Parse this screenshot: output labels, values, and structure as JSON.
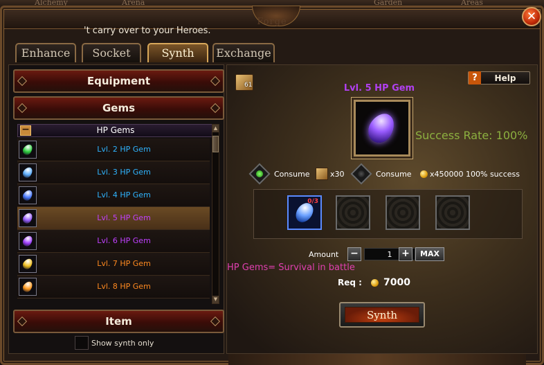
{
  "background_tabs": [
    "Alchemy",
    "Arena",
    "Garden",
    "Areas"
  ],
  "window": {
    "title": "Forge",
    "close_label": "✕"
  },
  "notice": "'t carry over to your Heroes.",
  "tabs": [
    {
      "label": "Enhance",
      "active": false
    },
    {
      "label": "Socket",
      "active": false
    },
    {
      "label": "Synth",
      "active": true
    },
    {
      "label": "Exchange",
      "active": false
    }
  ],
  "categories": {
    "equipment": "Equipment",
    "gems": "Gems",
    "item": "Item"
  },
  "subcategory": {
    "label": "HP Gems",
    "collapse": "−"
  },
  "gem_list": [
    {
      "label": "Lvl. 2 HP Gem",
      "color": "#2fb4ff",
      "gem": "#30d040",
      "selected": false
    },
    {
      "label": "Lvl. 3 HP Gem",
      "color": "#2fb4ff",
      "gem": "#60b0ff",
      "selected": false
    },
    {
      "label": "Lvl. 4 HP Gem",
      "color": "#2fb4ff",
      "gem": "#4a7aff",
      "selected": false
    },
    {
      "label": "Lvl. 5 HP Gem",
      "color": "#c040ff",
      "gem": "#9a60ff",
      "selected": true
    },
    {
      "label": "Lvl. 6 HP Gem",
      "color": "#c040ff",
      "gem": "#a040ff",
      "selected": false
    },
    {
      "label": "Lvl. 7 HP Gem",
      "color": "#ff8a20",
      "gem": "#f0c020",
      "selected": false
    },
    {
      "label": "Lvl. 8 HP Gem",
      "color": "#ff8a20",
      "gem": "#ff9a20",
      "selected": false
    }
  ],
  "show_synth_only": {
    "label": "Show synth only",
    "checked": false
  },
  "owned_count": "61",
  "help_label": "Help",
  "help_icon": "?",
  "target": {
    "name": "Lvl. 5 HP Gem",
    "name_color": "#b040f0"
  },
  "success_rate": "Success Rate: 100%",
  "consume_1": {
    "label": "Consume",
    "value": "x30"
  },
  "consume_2": {
    "label": "Consume",
    "value": "x450000 100% success"
  },
  "material_count": "0/3",
  "amount": {
    "label": "Amount",
    "minus": "−",
    "plus": "+",
    "value": "1",
    "max_label": "MAX"
  },
  "note": "HP Gems= Survival in battle",
  "requirement": {
    "label": "Req :",
    "value": "7000"
  },
  "synth_button": "Synth",
  "colors": {
    "accent_gold": "#d8a85a",
    "selected_row": "#6a4a24",
    "success_green": "#8cb040",
    "note_pink": "#e040b0"
  }
}
